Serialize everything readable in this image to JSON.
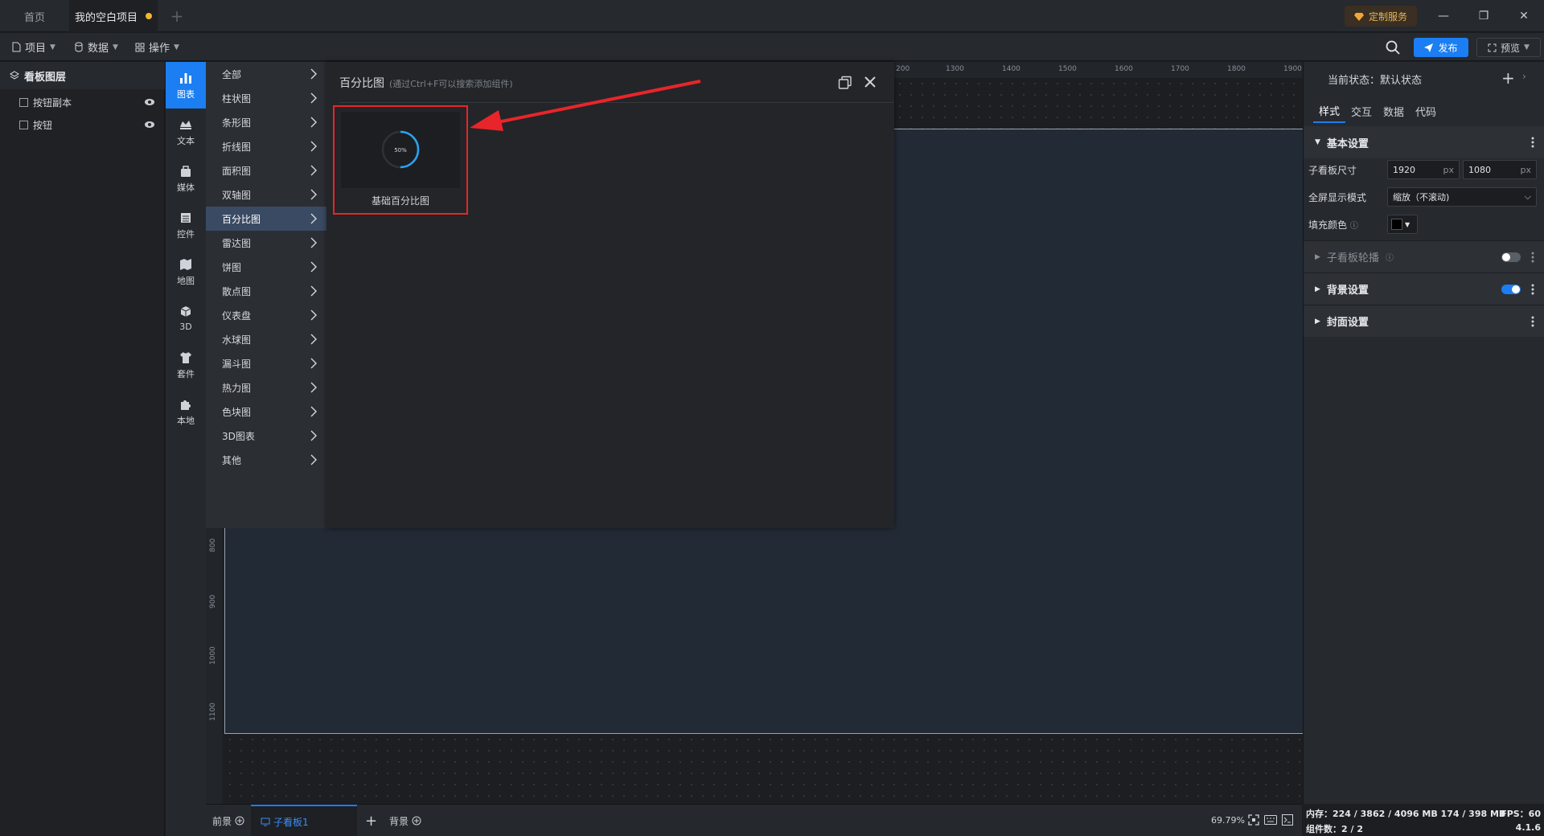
{
  "tabs": {
    "home": "首页",
    "project": "我的空白项目"
  },
  "custom_service": "定制服务",
  "menu": {
    "project": "项目",
    "data": "数据",
    "operation": "操作",
    "publish": "发布",
    "preview": "预览"
  },
  "layers": {
    "header": "看板图层",
    "items": [
      {
        "label": "按钮副本"
      },
      {
        "label": "按钮"
      }
    ]
  },
  "categories": [
    {
      "label": "图表",
      "icon": "bar-chart-icon"
    },
    {
      "label": "文本",
      "icon": "text-icon"
    },
    {
      "label": "媒体",
      "icon": "media-icon"
    },
    {
      "label": "控件",
      "icon": "widget-icon"
    },
    {
      "label": "地图",
      "icon": "map-icon"
    },
    {
      "label": "3D",
      "icon": "cube-icon"
    },
    {
      "label": "套件",
      "icon": "shirt-icon"
    },
    {
      "label": "本地",
      "icon": "puzzle-icon"
    }
  ],
  "chart_types": [
    {
      "label": "全部"
    },
    {
      "label": "柱状图"
    },
    {
      "label": "条形图"
    },
    {
      "label": "折线图"
    },
    {
      "label": "面积图"
    },
    {
      "label": "双轴图"
    },
    {
      "label": "百分比图"
    },
    {
      "label": "雷达图"
    },
    {
      "label": "饼图"
    },
    {
      "label": "散点图"
    },
    {
      "label": "仪表盘"
    },
    {
      "label": "水球图"
    },
    {
      "label": "漏斗图"
    },
    {
      "label": "热力图"
    },
    {
      "label": "色块图"
    },
    {
      "label": "3D图表"
    },
    {
      "label": "其他"
    }
  ],
  "popup": {
    "title": "百分比图",
    "hint": "(通过Ctrl+F可以搜索添加组件)",
    "card_label": "基础百分比图",
    "card_percent": "50%",
    "card_progress": 0.5
  },
  "ruler": {
    "top": [
      "200",
      "1300",
      "1400",
      "1500",
      "1600",
      "1700",
      "1800",
      "1900"
    ],
    "left": [
      "800",
      "900",
      "1000",
      "1100"
    ]
  },
  "bottom": {
    "front": "前景",
    "sub_board": "子看板1",
    "add": "+",
    "background": "背景",
    "zoom": "69.79%"
  },
  "right_panel": {
    "state": "当前状态：默认状态",
    "tabs": [
      "样式",
      "交互",
      "数据",
      "代码"
    ],
    "basic_settings": "基本设置",
    "board_size_label": "子看板尺寸",
    "width": "1920",
    "height": "1080",
    "unit": "px",
    "fullscreen_label": "全屏显示模式",
    "fullscreen_value": "缩放（不滚动)",
    "fill_label": "填充颜色",
    "fill_color": "#000000",
    "carousel": "子看板轮播",
    "background_settings": "背景设置",
    "cover_settings": "封面设置"
  },
  "status": {
    "memory": "内存：224 / 3862 / 4096 MB  174 / 398 MB",
    "fps": "FPS：60",
    "components": "组件数：2 / 2",
    "version": "4.1.6"
  },
  "colors": {
    "accent": "#1b7ef2",
    "highlight": "#e8252a",
    "dot": "#f2b630"
  }
}
